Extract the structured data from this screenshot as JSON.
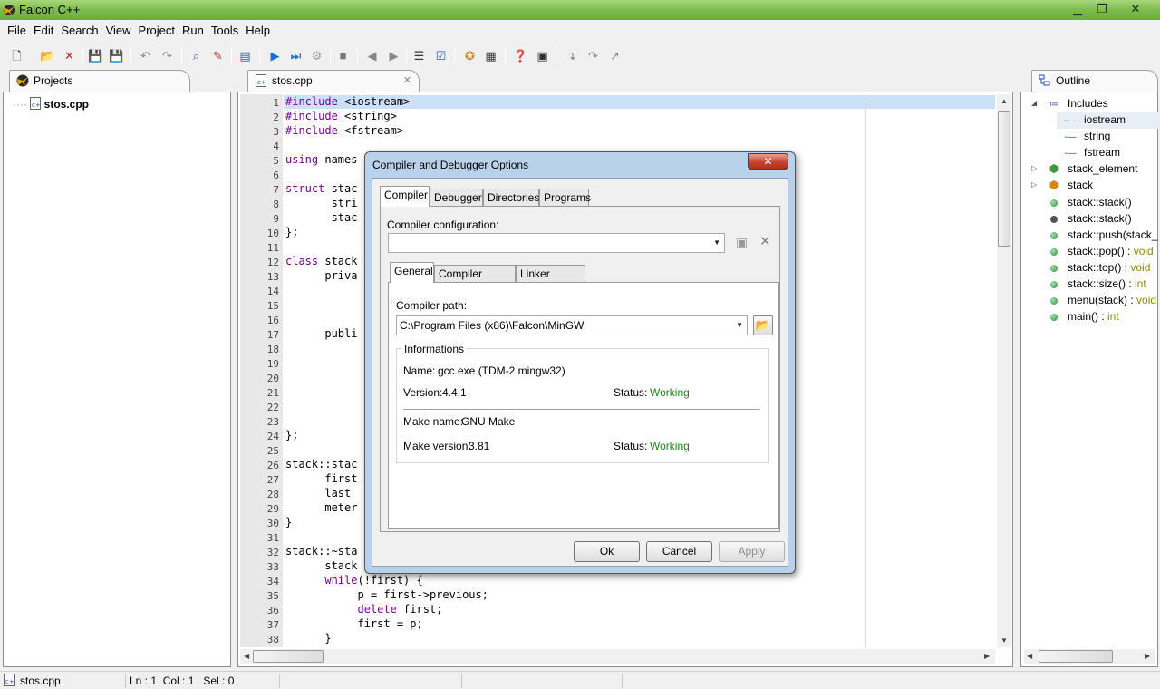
{
  "window": {
    "title": "Falcon C++"
  },
  "menu": [
    "File",
    "Edit",
    "Search",
    "View",
    "Project",
    "Run",
    "Tools",
    "Help"
  ],
  "projects": {
    "tab_label": "Projects",
    "tree": [
      {
        "label": "stos.cpp"
      }
    ]
  },
  "editor": {
    "tab_label": "stos.cpp",
    "lines": [
      "#include <iostream>",
      "#include <string>",
      "#include <fstream>",
      "",
      "using names",
      "",
      "struct stac",
      "       stri",
      "       stac",
      "};",
      "",
      "class stack",
      "      priva",
      "",
      "",
      "",
      "      publi",
      "",
      "",
      "",
      "",
      "",
      "",
      "};",
      "",
      "stack::stac",
      "      first",
      "      last ",
      "      meter",
      "}",
      "",
      "stack::~sta",
      "      stack",
      "      while(!first) {",
      "           p = first->previous;",
      "           delete first;",
      "           first = p;",
      "      }"
    ]
  },
  "outline": {
    "tab_label": "Outline",
    "items": [
      {
        "label": "Includes",
        "type": ""
      },
      {
        "label": "iostream",
        "type": ""
      },
      {
        "label": "string",
        "type": ""
      },
      {
        "label": "fstream",
        "type": ""
      },
      {
        "label": "stack_element",
        "type": ""
      },
      {
        "label": "stack",
        "type": ""
      },
      {
        "label": "stack::stack()",
        "type": ""
      },
      {
        "label": "stack::stack()",
        "type": ""
      },
      {
        "label": "stack::push(stack_",
        "type": ""
      },
      {
        "label": "stack::pop() : ",
        "type": "void"
      },
      {
        "label": "stack::top() : ",
        "type": "void"
      },
      {
        "label": "stack::size() : ",
        "type": "int"
      },
      {
        "label": "menu(stack) : ",
        "type": "void"
      },
      {
        "label": "main() : ",
        "type": "int"
      }
    ]
  },
  "statusbar": {
    "file": "stos.cpp",
    "position": "Ln : 1  Col : 1   Sel : 0"
  },
  "dialog": {
    "title": "Compiler and Debugger Options",
    "tabs": [
      "Compiler",
      "Debugger",
      "Directories",
      "Programs"
    ],
    "compiler_config_label": "Compiler configuration:",
    "compiler_config_value": "",
    "subtabs": [
      "General",
      "Compiler options",
      "Linker options"
    ],
    "compiler_path_label": "Compiler path:",
    "compiler_path_value": "C:\\Program Files (x86)\\Falcon\\MinGW",
    "info_group": "Informations",
    "name_label": "Name:",
    "name_value": "gcc.exe (TDM-2 mingw32)",
    "version_label": "Version:",
    "version_value": "4.4.1",
    "status_label": "Status:",
    "status_value": "Working",
    "make_name_label": "Make name:",
    "make_name_value": "GNU Make",
    "make_version_label": "Make version:",
    "make_version_value": "3.81",
    "make_status_label": "Status:",
    "make_status_value": "Working",
    "ok": "Ok",
    "cancel": "Cancel",
    "apply": "Apply"
  }
}
